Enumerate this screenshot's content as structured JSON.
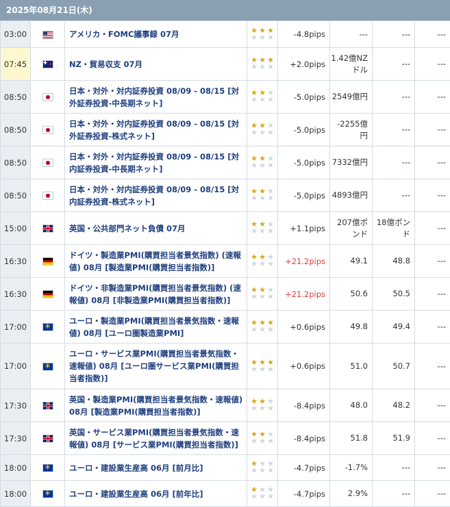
{
  "header": {
    "date": "2025年08月21日(木)"
  },
  "rows": [
    {
      "time": "03:00",
      "flag": "us",
      "flag_icon": "us-flag-icon",
      "event": "アメリカ・FOMC議事録 07月",
      "stars": "3",
      "pips": "-4.8pips",
      "prev": "---",
      "forecast": "---",
      "actual": "---",
      "highlight": false,
      "h": 39
    },
    {
      "time": "07:45",
      "flag": "nz",
      "flag_icon": "nz-flag-icon",
      "event": "NZ・貿易収支 07月",
      "stars": "3",
      "pips": "+2.0pips",
      "prev": "1.42億NZドル",
      "forecast": "---",
      "actual": "---",
      "highlight": true,
      "h": 48
    },
    {
      "time": "08:50",
      "flag": "jp",
      "flag_icon": "jp-flag-icon",
      "event": "日本・対外・対内証券投資 08/09 - 08/15 [対外証券投資-中長期ネット]",
      "stars": "2",
      "pips": "-5.0pips",
      "prev": "2549億円",
      "forecast": "---",
      "actual": "---",
      "highlight": false,
      "h": 48
    },
    {
      "time": "08:50",
      "flag": "jp",
      "flag_icon": "jp-flag-icon",
      "event": "日本・対外・対内証券投資 08/09 - 08/15 [対外証券投資-株式ネット]",
      "stars": "2",
      "pips": "-5.0pips",
      "prev": "-2255億円",
      "forecast": "---",
      "actual": "---",
      "highlight": false,
      "h": 48
    },
    {
      "time": "08:50",
      "flag": "jp",
      "flag_icon": "jp-flag-icon",
      "event": "日本・対外・対内証券投資 08/09 - 08/15 [対内証券投資-中長期ネット]",
      "stars": "2",
      "pips": "-5.0pips",
      "prev": "7332億円",
      "forecast": "---",
      "actual": "---",
      "highlight": false,
      "h": 48
    },
    {
      "time": "08:50",
      "flag": "jp",
      "flag_icon": "jp-flag-icon",
      "event": "日本・対外・対内証券投資 08/09 - 08/15 [対内証券投資-株式ネット]",
      "stars": "2",
      "pips": "-5.0pips",
      "prev": "4893億円",
      "forecast": "---",
      "actual": "---",
      "highlight": false,
      "h": 48
    },
    {
      "time": "15:00",
      "flag": "uk",
      "flag_icon": "uk-flag-icon",
      "event": "英国・公共部門ネット負債 07月",
      "stars": "2",
      "pips": "+1.1pips",
      "prev": "207億ポンド",
      "forecast": "18億ポンド",
      "actual": "---",
      "highlight": false,
      "h": 48
    },
    {
      "time": "16:30",
      "flag": "de",
      "flag_icon": "de-flag-icon",
      "event": "ドイツ・製造業PMI(購買担当者景気指数) (速報値) 08月 [製造業PMI(購買担当者指数)]",
      "stars": "2",
      "pips": "+21.2pips",
      "pips_strong": true,
      "prev": "49.1",
      "forecast": "48.8",
      "actual": "---",
      "highlight": false,
      "h": 48
    },
    {
      "time": "16:30",
      "flag": "de",
      "flag_icon": "de-flag-icon",
      "event": "ドイツ・非製造業PMI(購買担当者景気指数) (速報値) 08月 [非製造業PMI(購買担当者指数)]",
      "stars": "2",
      "pips": "+21.2pips",
      "pips_strong": true,
      "prev": "50.6",
      "forecast": "50.5",
      "actual": "---",
      "highlight": false,
      "h": 48
    },
    {
      "time": "17:00",
      "flag": "eu",
      "flag_icon": "eu-flag-icon",
      "event": "ユーロ・製造業PMI(購買担当者景気指数・速報値) 08月 [ユーロ圏製造業PMI]",
      "stars": "3",
      "pips": "+0.6pips",
      "prev": "49.8",
      "forecast": "49.4",
      "actual": "---",
      "highlight": false,
      "h": 48
    },
    {
      "time": "17:00",
      "flag": "eu",
      "flag_icon": "eu-flag-icon",
      "event": "ユーロ・サービス業PMI(購買担当者景気指数・速報値) 08月 [ユーロ圏サービス業PMI(購買担当者指数)]",
      "stars": "3",
      "pips": "+0.6pips",
      "prev": "51.0",
      "forecast": "50.7",
      "actual": "---",
      "highlight": false,
      "h": 67
    },
    {
      "time": "17:30",
      "flag": "uk",
      "flag_icon": "uk-flag-icon",
      "event": "英国・製造業PMI(購買担当者景気指数・速報値) 08月 [製造業PMI(購買担当者指数)]",
      "stars": "2",
      "pips": "-8.4pips",
      "prev": "48.0",
      "forecast": "48.2",
      "actual": "---",
      "highlight": false,
      "h": 48
    },
    {
      "time": "17:30",
      "flag": "uk",
      "flag_icon": "uk-flag-icon",
      "event": "英国・サービス業PMI(購買担当者景気指数・速報値) 08月 [サービス業PMI(購買担当者指数)]",
      "stars": "2",
      "pips": "-8.4pips",
      "prev": "51.8",
      "forecast": "51.9",
      "actual": "---",
      "highlight": false,
      "h": 48
    },
    {
      "time": "18:00",
      "flag": "eu",
      "flag_icon": "eu-flag-icon",
      "event": "ユーロ・建設業生産高 06月 [前月比]",
      "stars": "1",
      "pips": "-4.7pips",
      "prev": "-1.7%",
      "forecast": "---",
      "actual": "---",
      "highlight": false,
      "h": 38
    },
    {
      "time": "18:00",
      "flag": "eu",
      "flag_icon": "eu-flag-icon",
      "event": "ユーロ・建設業生産高 06月 [前年比]",
      "stars": "1",
      "pips": "-4.7pips",
      "prev": "2.9%",
      "forecast": "---",
      "actual": "---",
      "highlight": false,
      "h": 38
    }
  ],
  "colors": {
    "header_bg": "#8aa0b2",
    "event_link": "#1f3f7f",
    "star_on": "#d9a61c",
    "star_off": "#cfd6dc",
    "pips_strong": "#e23b3b",
    "highlight_time": "#fdf8cf"
  }
}
